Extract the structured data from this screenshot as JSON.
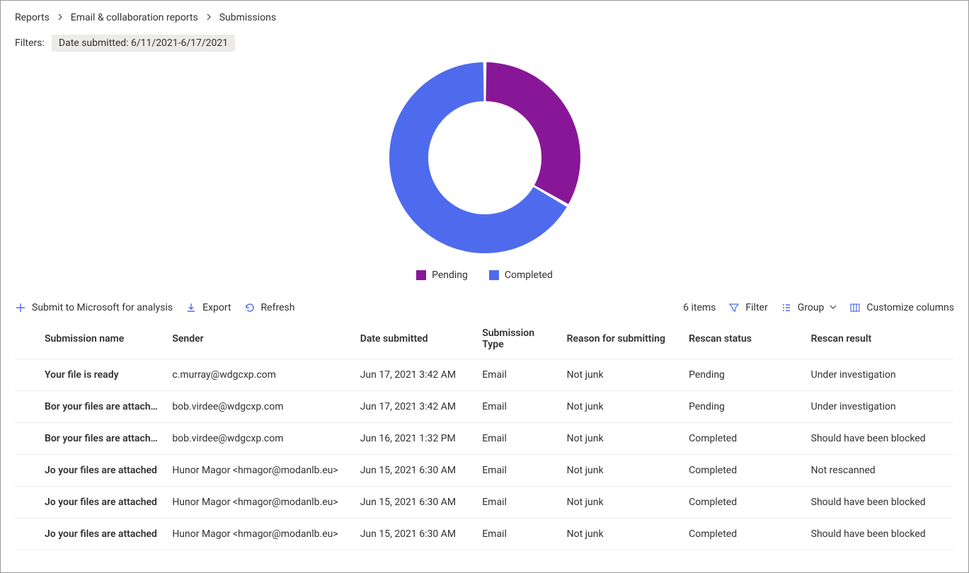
{
  "breadcrumb": {
    "items": [
      "Reports",
      "Email & collaboration reports",
      "Submissions"
    ]
  },
  "filters": {
    "label": "Filters:",
    "chip": "Date submitted: 6/11/2021-6/17/2021"
  },
  "chart_data": {
    "type": "pie",
    "title": "",
    "series": [
      {
        "name": "Pending",
        "value": 2,
        "color": "#881798"
      },
      {
        "name": "Completed",
        "value": 4,
        "color": "#4f6bed"
      }
    ]
  },
  "legend": {
    "items": [
      {
        "label": "Pending",
        "color": "#881798"
      },
      {
        "label": "Completed",
        "color": "#4f6bed"
      }
    ]
  },
  "toolbar": {
    "submit": "Submit to Microsoft for analysis",
    "export": "Export",
    "refresh": "Refresh",
    "count": "6 items",
    "filter": "Filter",
    "group": "Group",
    "customize": "Customize columns"
  },
  "table": {
    "headers": {
      "name": "Submission name",
      "sender": "Sender",
      "date": "Date submitted",
      "type": "Submission Type",
      "reason": "Reason for submitting",
      "rstatus": "Rescan status",
      "rresult": "Rescan result"
    },
    "rows": [
      {
        "name": "Your file is ready",
        "sender": "c.murray@wdgcxp.com",
        "date": "Jun 17, 2021 3:42 AM",
        "type": "Email",
        "reason": "Not junk",
        "rstatus": "Pending",
        "rresult": "Under investigation"
      },
      {
        "name": "Bor your files are attached",
        "sender": "bob.virdee@wdgcxp.com",
        "date": "Jun 17, 2021 3:42 AM",
        "type": "Email",
        "reason": "Not junk",
        "rstatus": "Pending",
        "rresult": "Under investigation"
      },
      {
        "name": "Bor your files are attached",
        "sender": "bob.virdee@wdgcxp.com",
        "date": "Jun 16, 2021 1:32 PM",
        "type": "Email",
        "reason": "Not junk",
        "rstatus": "Completed",
        "rresult": "Should have been blocked"
      },
      {
        "name": "Jo your files are attached",
        "sender": "Hunor Magor <hmagor@modanlb.eu>",
        "date": "Jun 15, 2021 6:30 AM",
        "type": "Email",
        "reason": "Not junk",
        "rstatus": "Completed",
        "rresult": "Not rescanned"
      },
      {
        "name": "Jo your files are attached",
        "sender": "Hunor Magor <hmagor@modanlb.eu>",
        "date": "Jun 15, 2021 6:30 AM",
        "type": "Email",
        "reason": "Not junk",
        "rstatus": "Completed",
        "rresult": "Should have been blocked"
      },
      {
        "name": "Jo your files are attached",
        "sender": "Hunor Magor <hmagor@modanlb.eu>",
        "date": "Jun 15, 2021 6:30 AM",
        "type": "Email",
        "reason": "Not junk",
        "rstatus": "Completed",
        "rresult": "Should have been blocked"
      }
    ]
  }
}
